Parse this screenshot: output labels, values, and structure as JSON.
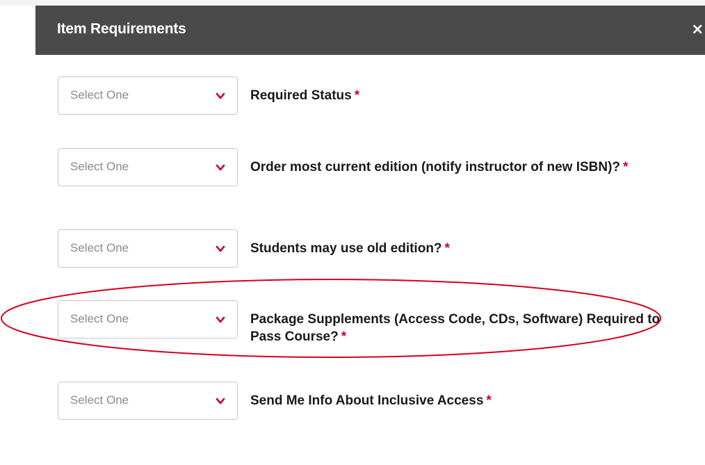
{
  "modal": {
    "title": "Item Requirements",
    "close_symbol": "×"
  },
  "rows": [
    {
      "select_value": "Select One",
      "label": "Required Status",
      "required_mark": "*"
    },
    {
      "select_value": "Select One",
      "label": "Order most current edition (notify instructor of new ISBN)?",
      "required_mark": "*"
    },
    {
      "select_value": "Select One",
      "label": "Students may use old edition?",
      "required_mark": "*"
    },
    {
      "select_value": "Select One",
      "label": "Package Supplements (Access Code, CDs, Software) Required to Pass Course?",
      "required_mark": "*"
    },
    {
      "select_value": "Select One",
      "label": "Send Me Info About Inclusive Access",
      "required_mark": "*"
    }
  ],
  "colors": {
    "header_bg": "#4a4a4a",
    "accent": "#cc0033",
    "annotation": "#d4001a"
  },
  "icons": {
    "close": "close-icon",
    "dropdown": "chevron-down-icon"
  }
}
